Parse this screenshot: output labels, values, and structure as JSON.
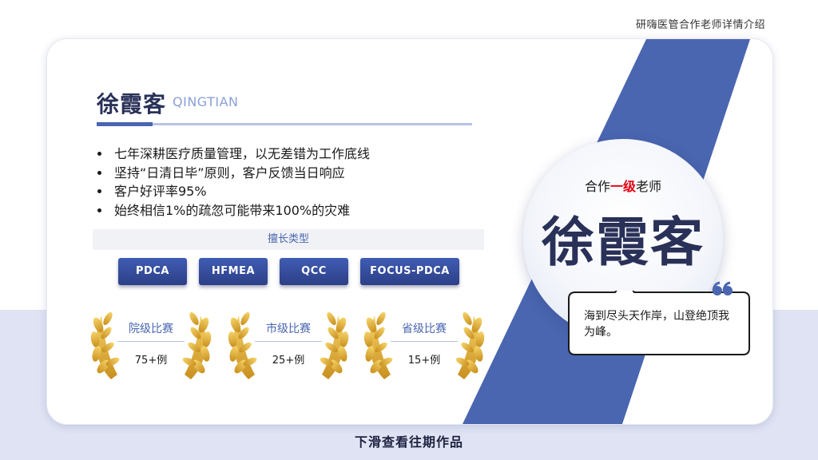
{
  "header": {
    "caption": "研嗨医管合作老师详情介绍"
  },
  "profile": {
    "name": "徐霞客",
    "pinyin": "QINGTIAN",
    "bullets": [
      "七年深耕医疗质量管理，以无差错为工作底线",
      "坚持“日清日毕”原则，客户反馈当日响应",
      "客户好评率95%",
      "始终相信1%的疏忽可能带来100%的灾难"
    ]
  },
  "skills": {
    "header": "擅长类型",
    "items": [
      "PDCA",
      "HFMEA",
      "QCC",
      "FOCUS-PDCA"
    ]
  },
  "awards": [
    {
      "title": "院级比赛",
      "value": "75+例"
    },
    {
      "title": "市级比赛",
      "value": "25+例"
    },
    {
      "title": "省级比赛",
      "value": "15+例"
    }
  ],
  "badge": {
    "prefix": "合作",
    "highlight": "一级",
    "suffix": "老师",
    "name": "徐霞客",
    "quote": "海到尽头天作岸，山登绝顶我为峰。",
    "quote_icon": "quote-mark-icon"
  },
  "footer": {
    "text": "下滑查看往期作品"
  },
  "colors": {
    "accent_blue": "#4a66b0",
    "navy": "#2a3158",
    "highlight_red": "#e60012",
    "award_gold": "#e0b33a",
    "band": "#dfe3f3"
  }
}
